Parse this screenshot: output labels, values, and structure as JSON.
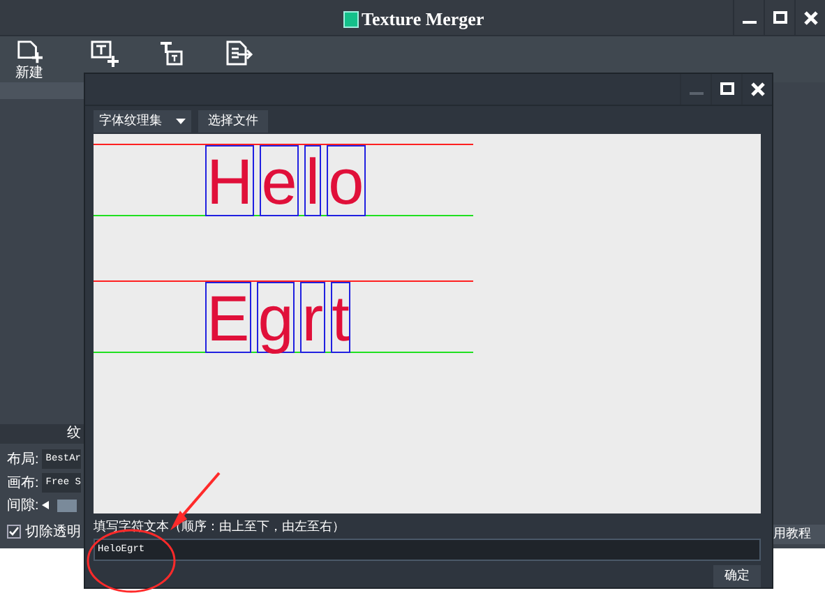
{
  "window": {
    "title": "Texture Merger"
  },
  "toolbar": [
    {
      "kind": "new",
      "label": "新建"
    },
    {
      "kind": "add-text"
    },
    {
      "kind": "text"
    },
    {
      "kind": "export"
    }
  ],
  "left_panel": {
    "heading": "纹",
    "rows": [
      {
        "label": "布局:",
        "value": "BestAr"
      },
      {
        "label": "画布:",
        "value": "Free S"
      }
    ],
    "gap_label": "间隙:",
    "trim": {
      "label": "切除透明",
      "checked": true
    }
  },
  "right_panel": {
    "button": "用教程"
  },
  "dialog": {
    "dropdown": "字体纹理集",
    "choose_button": "选择文件",
    "glyph_rows": [
      {
        "glyphs": [
          "H",
          "e",
          "l",
          "o"
        ]
      },
      {
        "glyphs": [
          "E",
          "g",
          "r",
          "t"
        ]
      }
    ],
    "input_label": "填写字符文本（顺序：由上至下，由左至右）",
    "input_value": "HeloEgrt",
    "ok_button": "确定"
  }
}
